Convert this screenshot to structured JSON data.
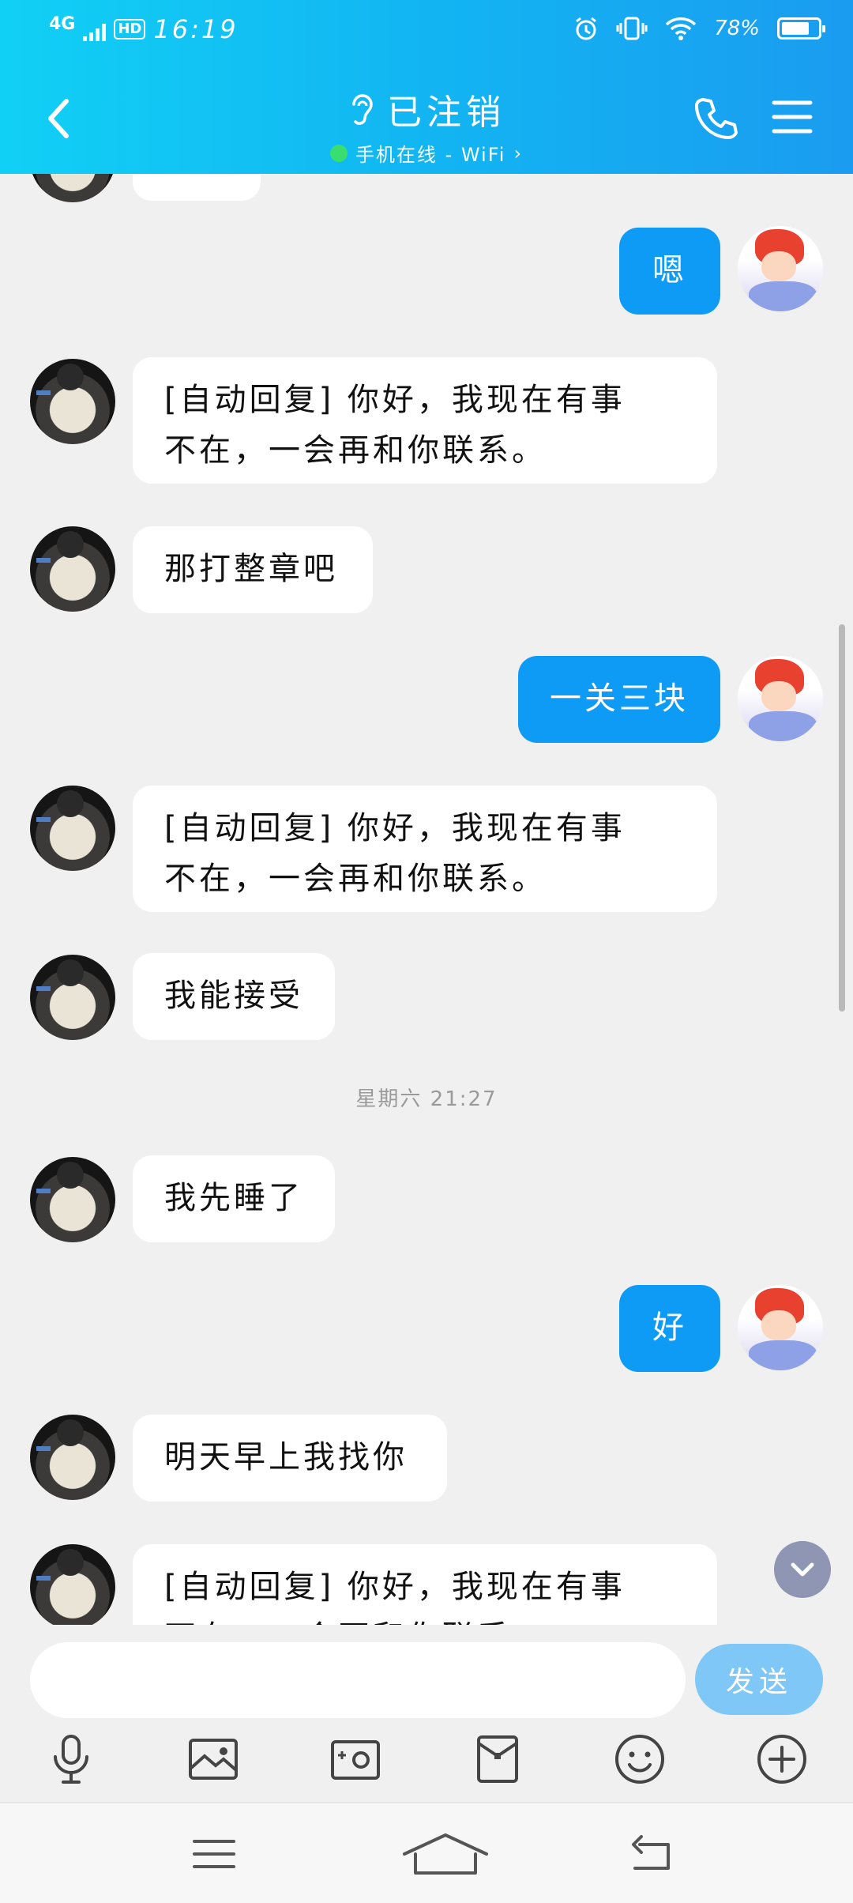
{
  "status_bar": {
    "network": "4G",
    "hd": "HD",
    "time": "16:19",
    "battery_percent_text": "78%",
    "battery_level": 0.78,
    "icons": [
      "signal-icon",
      "alarm-icon",
      "vibrate-icon",
      "wifi-icon",
      "battery-icon"
    ]
  },
  "header": {
    "back_icon": "chevron-left-icon",
    "ear_icon": "ear-icon",
    "title": "已注销",
    "status_text": "手机在线 - WiFi",
    "status_arrow": "›",
    "online_color": "#3be06a",
    "phone_icon": "phone-icon",
    "menu_icon": "menu-icon",
    "gradient": [
      "#11d0f5",
      "#1a9cf0"
    ]
  },
  "messages": [
    {
      "side": "self",
      "text": "嗯"
    },
    {
      "side": "other",
      "text": "[自动回复] 你好，我现在有事\n不在，一会再和你联系。"
    },
    {
      "side": "other",
      "text": "那打整章吧"
    },
    {
      "side": "self",
      "text": "一关三块"
    },
    {
      "side": "other",
      "text": "[自动回复] 你好，我现在有事\n不在，一会再和你联系。"
    },
    {
      "side": "other",
      "text": "我能接受"
    },
    {
      "side": "other",
      "text": "我先睡了"
    },
    {
      "side": "self",
      "text": "好"
    },
    {
      "side": "other",
      "text": "明天早上我找你"
    },
    {
      "side": "other",
      "text": "[自动回复] 你好，我现在有事\n不在，一会再和你联系。"
    }
  ],
  "timestamp": "星期六 21:27",
  "colors": {
    "self_bubble": "#0d9bf5",
    "other_bubble": "#ffffff",
    "background": "#f0f0f0"
  },
  "input": {
    "value": "",
    "placeholder": "",
    "send_label": "发送"
  },
  "toolbar": [
    "microphone-icon",
    "image-icon",
    "camera-icon",
    "red-packet-icon",
    "emoji-icon",
    "plus-icon"
  ],
  "navbar": [
    "menu-icon",
    "home-icon",
    "back-icon"
  ]
}
